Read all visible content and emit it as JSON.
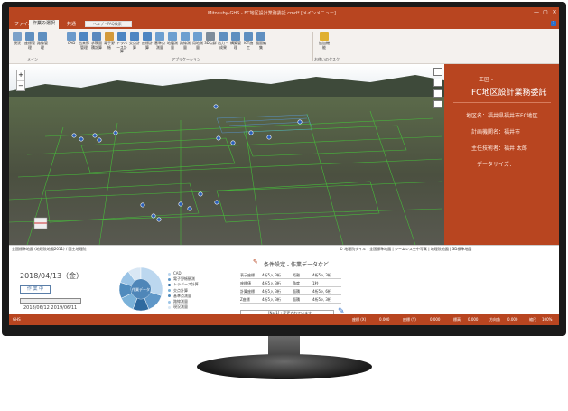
{
  "window": {
    "app_title": "Mitosuby-GHS - FC地区設計業務委託.cmd* [メインメニュー]",
    "minimize": "—",
    "maximize": "▢",
    "close": "✕"
  },
  "tabs": [
    {
      "label": "ファイル",
      "active": false
    },
    {
      "label": "作業の選択",
      "active": true
    },
    {
      "label": "共通",
      "active": false
    }
  ],
  "search": {
    "placeholder": "ヘルプ・FAQ検索"
  },
  "help_label": "?",
  "ribbon": {
    "groups": [
      {
        "label": "メイン"
      },
      {
        "label": "アプリケーション"
      },
      {
        "label": "お使いのタスク"
      }
    ],
    "buttons": [
      {
        "label": "現況",
        "icon": "document-icon",
        "color": "#7ba1c9"
      },
      {
        "label": "座標管理",
        "icon": "coordinate-icon",
        "color": "#5f8fc0"
      },
      {
        "label": "路線管理",
        "icon": "route-icon",
        "color": "#5f8fc0"
      },
      {
        "label": "CAD",
        "icon": "cad-icon",
        "color": "#6b9acb"
      },
      {
        "label": "出来形管理",
        "icon": "measure-icon",
        "color": "#4e86c2"
      },
      {
        "label": "求積面積計算",
        "icon": "area-icon",
        "color": "#5a89be"
      },
      {
        "label": "電子野帳",
        "icon": "field-book-icon",
        "color": "#d49a3a"
      },
      {
        "label": "トラバース計算",
        "icon": "traverse-icon",
        "color": "#4e86c2"
      },
      {
        "label": "交点計算",
        "icon": "intersection-icon",
        "color": "#4e86c2"
      },
      {
        "label": "座標計算",
        "icon": "calc-icon",
        "color": "#4e86c2"
      },
      {
        "label": "基準点測量",
        "icon": "benchmark-icon",
        "color": "#6d9fd0"
      },
      {
        "label": "地籍測量",
        "icon": "cadastral-icon",
        "color": "#6d9fd0"
      },
      {
        "label": "路線測量",
        "icon": "route-survey-icon",
        "color": "#6d9fd0"
      },
      {
        "label": "用地測量",
        "icon": "land-icon",
        "color": "#6d9fd0"
      },
      {
        "label": "3D点群",
        "icon": "pointcloud-icon",
        "color": "#7e8c9a"
      },
      {
        "label": "出力・成果",
        "icon": "output-icon",
        "color": "#5f8fc0"
      },
      {
        "label": "構築管理",
        "icon": "build-icon",
        "color": "#5f8fc0"
      },
      {
        "label": "ICT施工",
        "icon": "ict-icon",
        "color": "#5f8fc0"
      },
      {
        "label": "図面編集",
        "icon": "drawing-icon",
        "color": "#5f8fc0"
      },
      {
        "label": "追加機能",
        "icon": "star-icon",
        "color": "#e0b030"
      }
    ]
  },
  "map": {
    "status_left": "全国標準地図 (地理院地図2011) / 国土地理院",
    "status_right": "© 地理院タイル | 全国標準地図 | シームレス空中写真 | 地理院地図 | 3D標準地図"
  },
  "side_panel": {
    "work_type": "工区 -",
    "project_name": "FC地区設計業務委託",
    "fields": [
      {
        "label": "地区名：福井県福井市FC地区"
      },
      {
        "label": "計画機関名：福井市"
      },
      {
        "label": "主任技術者：福井 太郎"
      },
      {
        "label": "データサイズ："
      }
    ]
  },
  "bottom": {
    "date": "2018/04/13（金）",
    "work_button": "作 業 中",
    "progress": 0.0,
    "start_date": "2018/06/12",
    "end_date": "2019/06/11",
    "chart_center_label": "作業データ",
    "legend": [
      {
        "label": "CAD",
        "color": "#bcd7ef"
      },
      {
        "label": "電子野帳観測",
        "color": "#5f97c8"
      },
      {
        "label": "トラバース計算",
        "color": "#2f6a9f"
      },
      {
        "label": "交点計算",
        "color": "#7bb2d9"
      },
      {
        "label": "基準点測量",
        "color": "#4f8bbd"
      },
      {
        "label": "路線測量",
        "color": "#9bc4e6"
      },
      {
        "label": "現況測量",
        "color": "#d9e7f4"
      }
    ],
    "conditions_title": "条件設定 - 作業データなど",
    "conditions": [
      {
        "k1": "表示座標",
        "v1": "4桁5入 3桁",
        "k2": "距離",
        "v2": "4桁5入 3桁"
      },
      {
        "k1": "座標値",
        "v1": "4桁5入 3桁",
        "k2": "角度",
        "v2": "1秒"
      },
      {
        "k1": "計算座標",
        "v1": "4桁5入 3桁",
        "k2": "面積",
        "v2": "4桁5入 6桁"
      },
      {
        "k1": "Z座標",
        "v1": "4桁5入 3桁",
        "k2": "面積",
        "v2": "4桁5入 3桁"
      }
    ],
    "conditions_footer": "[No.1] : 変更されています"
  },
  "statusbar": {
    "left": "GHS",
    "items": [
      "座標 (X)",
      "0.000",
      "座標 (Y)",
      "0.000",
      "標高",
      "0.000",
      "方向角",
      "0.000",
      "縮尺",
      "100%"
    ]
  }
}
